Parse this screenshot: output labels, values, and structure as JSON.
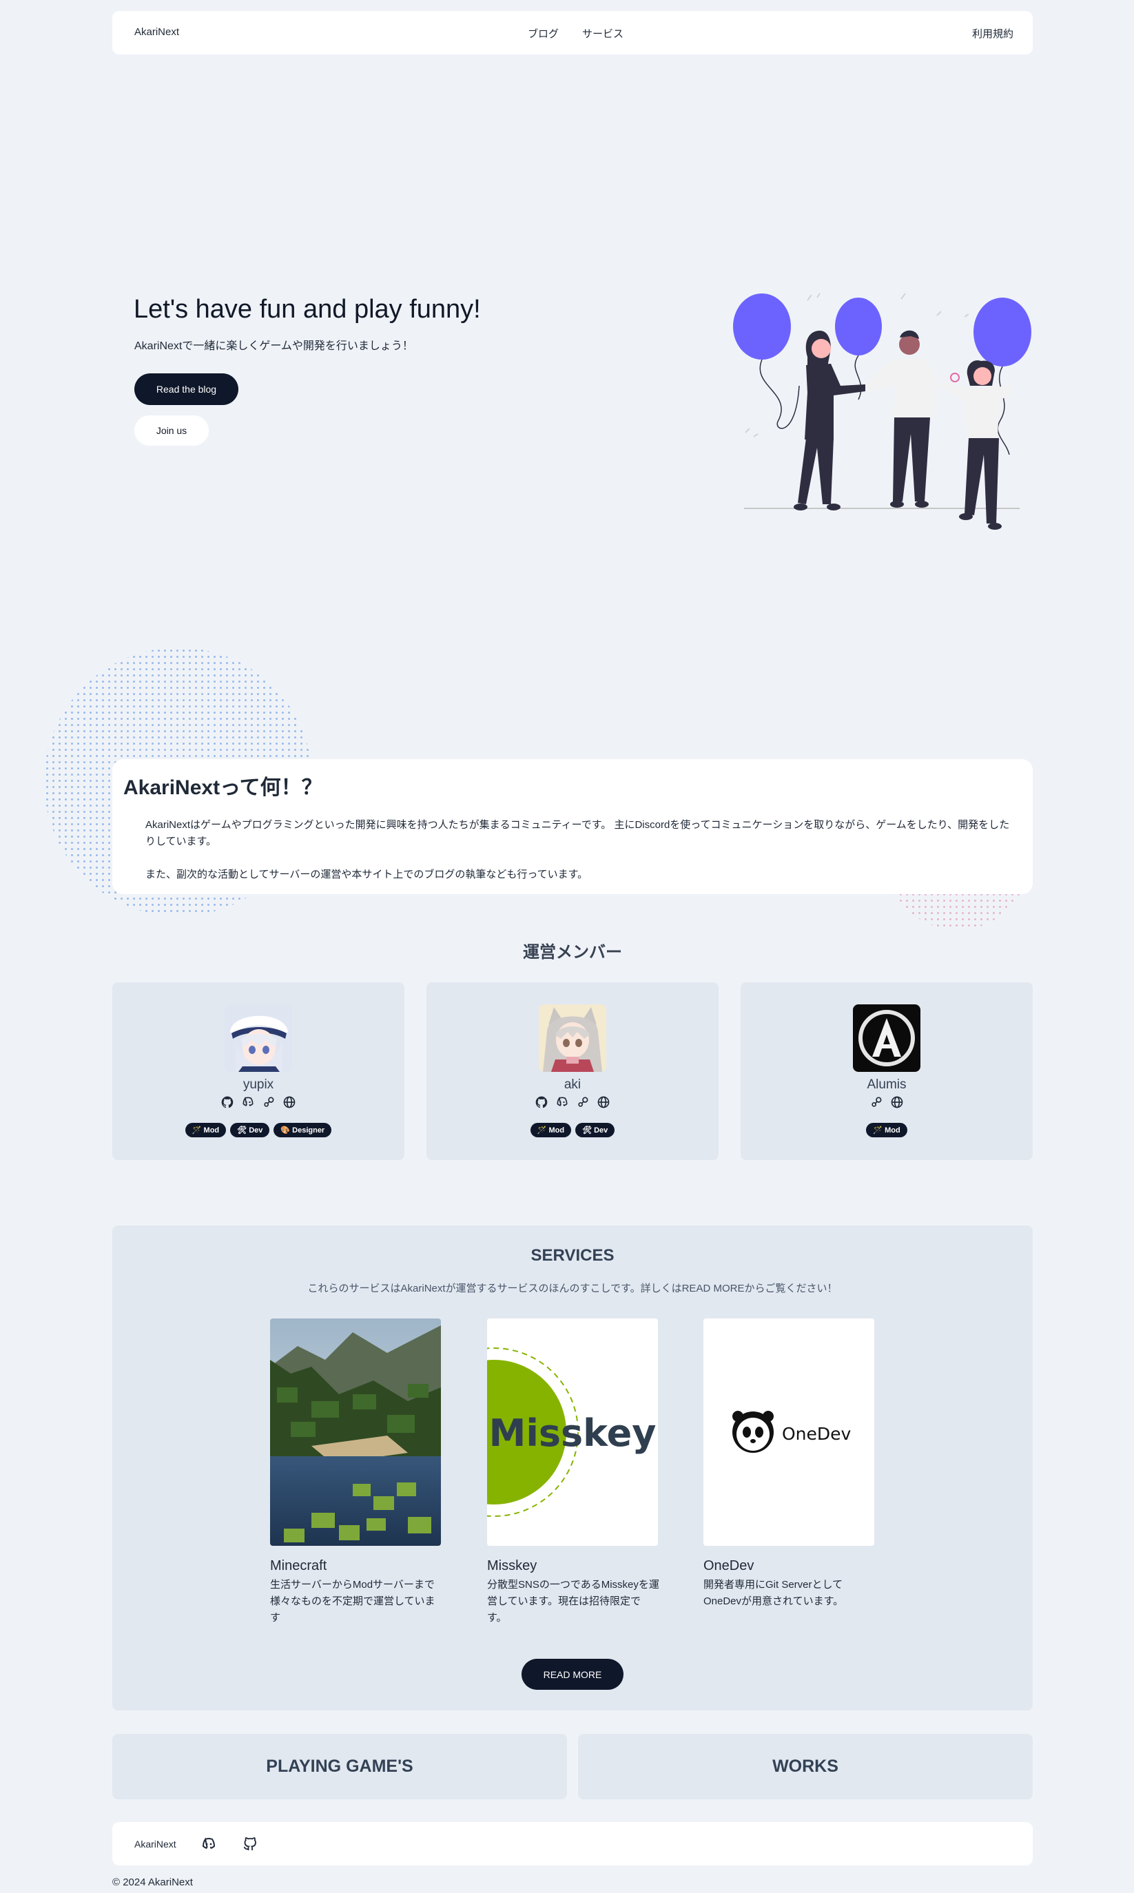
{
  "nav": {
    "brand": "AkariNext",
    "links": [
      "ブログ",
      "サービス"
    ],
    "right_link": "利用規約"
  },
  "hero": {
    "title": "Let's have fun and play funny!",
    "subtitle": "AkariNextで一緒に楽しくゲームや開発を行いましょう！",
    "primary_button": "Read the blog",
    "secondary_button": "Join us"
  },
  "about": {
    "title": "AkariNextって何！？",
    "paragraph1": "AkariNextはゲームやプログラミングといった開発に興味を持つ人たちが集まるコミュニティーです。 主にDiscordを使ってコミュニケーションを取りながら、ゲームをしたり、開発をしたりしています。",
    "paragraph2": "また、副次的な活動としてサーバーの運営や本サイト上でのブログの執筆なども行っています。"
  },
  "members": {
    "title": "運営メンバー",
    "list": [
      {
        "name": "yupix",
        "icons": [
          "github-icon",
          "discord-icon",
          "steam-icon",
          "globe-icon"
        ],
        "badges": [
          "Mod",
          "Dev",
          "Designer"
        ]
      },
      {
        "name": "aki",
        "icons": [
          "github-icon",
          "discord-icon",
          "steam-icon",
          "globe-icon"
        ],
        "badges": [
          "Mod",
          "Dev"
        ]
      },
      {
        "name": "Alumis",
        "icons": [
          "steam-icon",
          "globe-icon"
        ],
        "badges": [
          "Mod"
        ]
      }
    ]
  },
  "services": {
    "title": "SERVICES",
    "description": "これらのサービスはAkariNextが運営するサービスのほんのすこしです。詳しくはREAD MOREからご覧ください！",
    "items": [
      {
        "name": "Minecraft",
        "description": "生活サーバーからModサーバーまで様々なものを不定期で運営しています"
      },
      {
        "name": "Misskey",
        "description": "分散型SNSの一つであるMisskeyを運営しています。現在は招待限定です。",
        "logo_text": "Misskey"
      },
      {
        "name": "OneDev",
        "description": "開発者専用にGit Serverとして OneDevが用意されています。",
        "logo_text": "OneDev"
      }
    ],
    "read_more": "READ MORE"
  },
  "tiles": {
    "games": "PLAYING GAME'S",
    "works": "WORKS"
  },
  "footer": {
    "brand": "AkariNext",
    "copyright": "© 2024 AkariNext"
  },
  "colors": {
    "background": "#eff3f8",
    "dark": "#0f172a",
    "balloon": "#6c63ff",
    "card": "#e2e8f0",
    "misskey_green": "#86b300"
  }
}
